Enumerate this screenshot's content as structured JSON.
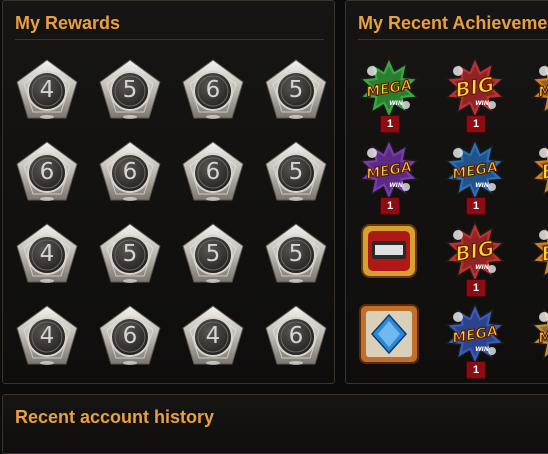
{
  "rewards": {
    "title": "My Rewards",
    "badges": [
      [
        "4",
        "5",
        "6",
        "5"
      ],
      [
        "6",
        "6",
        "6",
        "5"
      ],
      [
        "4",
        "5",
        "5",
        "5"
      ],
      [
        "4",
        "6",
        "4",
        "6"
      ]
    ]
  },
  "achievements": {
    "title": "My Recent Achievements",
    "items": [
      [
        {
          "kind": "mega",
          "color": "#3aa840",
          "count": "1"
        },
        {
          "kind": "big",
          "color": "#c03030",
          "count": "1"
        },
        {
          "kind": "mega",
          "color": "#d08020",
          "count": ""
        }
      ],
      [
        {
          "kind": "mega",
          "color": "#7a3ab0",
          "count": "1"
        },
        {
          "kind": "mega",
          "color": "#2a6fb8",
          "count": "1"
        },
        {
          "kind": "big",
          "color": "#d08020",
          "count": ""
        }
      ],
      [
        {
          "kind": "machine",
          "color": "#c02020",
          "count": ""
        },
        {
          "kind": "big",
          "color": "#c03030",
          "count": "1"
        },
        {
          "kind": "big",
          "color": "#d08020",
          "count": ""
        }
      ],
      [
        {
          "kind": "diamond",
          "color": "#2a8ad8",
          "count": ""
        },
        {
          "kind": "mega",
          "color": "#3a5ab8",
          "count": "1"
        },
        {
          "kind": "mega",
          "color": "#c09040",
          "count": ""
        }
      ]
    ],
    "labels": {
      "mega": "MEGA",
      "big": "BIG",
      "win": "WIN"
    }
  },
  "history": {
    "title": "Recent account history"
  }
}
